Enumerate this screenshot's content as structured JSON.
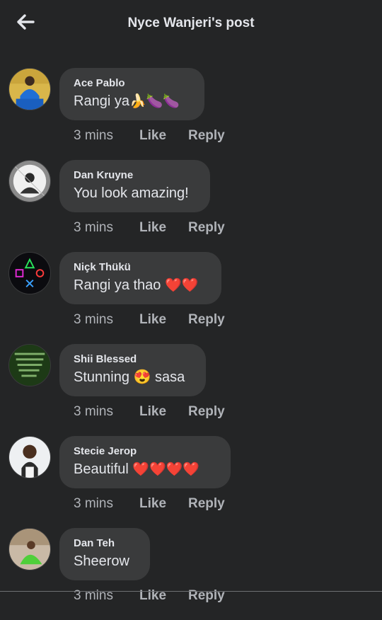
{
  "header": {
    "title": "Nyce Wanjeri's post"
  },
  "comments": [
    {
      "author": "Ace Pablo",
      "text": "Rangi ya",
      "emojis": "🍌🍆🍆",
      "time": "3 mins",
      "like": "Like",
      "reply": "Reply"
    },
    {
      "author": "Dan Kruyne",
      "text": "You look amazing!",
      "emojis": "",
      "time": "3 mins",
      "like": "Like",
      "reply": "Reply"
    },
    {
      "author": "Niçk Thükü",
      "text": "Rangi ya thao",
      "emojis": "❤️❤️",
      "time": "3 mins",
      "like": "Like",
      "reply": "Reply"
    },
    {
      "author": "Shii Blessed",
      "text": "Stunning 😍 sasa",
      "emojis": "",
      "time": "3 mins",
      "like": "Like",
      "reply": "Reply"
    },
    {
      "author": "Stecie Jerop",
      "text": "Beautiful",
      "emojis": "❤️❤️❤️❤️",
      "time": "3 mins",
      "like": "Like",
      "reply": "Reply"
    },
    {
      "author": "Dan Teh",
      "text": "Sheerow",
      "emojis": "",
      "time": "3 mins",
      "like": "Like",
      "reply": "Reply"
    }
  ],
  "colors": {
    "background": "#242526",
    "bubble": "#3a3b3c",
    "text": "#e4e6eb",
    "meta": "#b0b3b8"
  },
  "icons": {
    "back": "back-arrow-icon"
  }
}
